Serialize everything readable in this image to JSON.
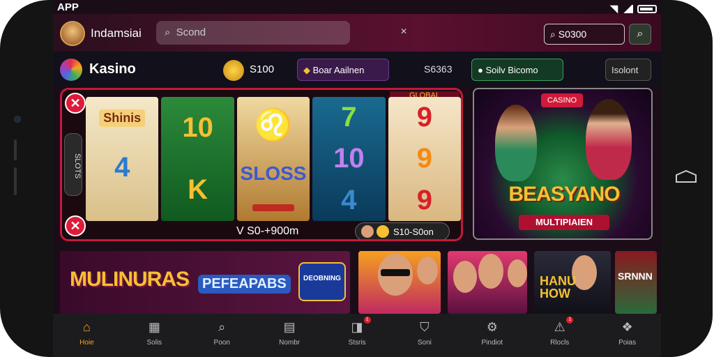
{
  "statusbar": {
    "app_label": "APP"
  },
  "topbar": {
    "brand": "Indamsiai",
    "search_text": "Scond",
    "balance": "S0300"
  },
  "section": {
    "title": "Kasino",
    "coins": "S100",
    "chip1_label": "Boar Aailnen",
    "value_text": "S6363",
    "chip2_label": "Soilv Bicomo",
    "chip3_label": "Isolont"
  },
  "slot": {
    "tag": "GLOBAL",
    "side_text": "SLOTS",
    "reel1": {
      "badge": "Shinis",
      "value": "4"
    },
    "reel2": {
      "top": "10",
      "mid": "K"
    },
    "reel3": {
      "mid": "SLOSS"
    },
    "reel4": {
      "top": "7",
      "mid": "10",
      "bottom": "4"
    },
    "reel5": {
      "top": "9",
      "mid": "9",
      "bottom": "9"
    },
    "bottom_label": "V S0-+900m",
    "pill_label": "S10-S0on"
  },
  "casino_card": {
    "badge": "CASINO",
    "title": "BEASYANO",
    "subtitle": "MULTIPIAIEN"
  },
  "banner": {
    "text1": "MULINURAS",
    "text2": "PEFEAPABS",
    "text3": "DEOBNING"
  },
  "thumbs": {
    "t3_text": "HANU\nHOW",
    "t4_text": "SRNNN"
  },
  "nav": [
    {
      "label": "Hoie",
      "icon": "home-icon",
      "glyph": "⌂",
      "active": true
    },
    {
      "label": "Solis",
      "icon": "slots-icon",
      "glyph": "▦"
    },
    {
      "label": "Poon",
      "icon": "search-icon",
      "glyph": "⌕"
    },
    {
      "label": "Nombr",
      "icon": "inbox-icon",
      "glyph": "▤"
    },
    {
      "label": "Stsris",
      "icon": "tag-icon",
      "glyph": "◨",
      "badge": "1"
    },
    {
      "label": "Soni",
      "icon": "shield-icon",
      "glyph": "⛉"
    },
    {
      "label": "Pindiot",
      "icon": "gear-icon",
      "glyph": "⚙"
    },
    {
      "label": "Rlocls",
      "icon": "alert-icon",
      "glyph": "⚠",
      "badge": "1"
    },
    {
      "label": "Poias",
      "icon": "grid-icon",
      "glyph": "❖"
    }
  ],
  "colors": {
    "accent": "#f5a623",
    "brand": "#5a1030",
    "danger": "#e01a3a"
  }
}
